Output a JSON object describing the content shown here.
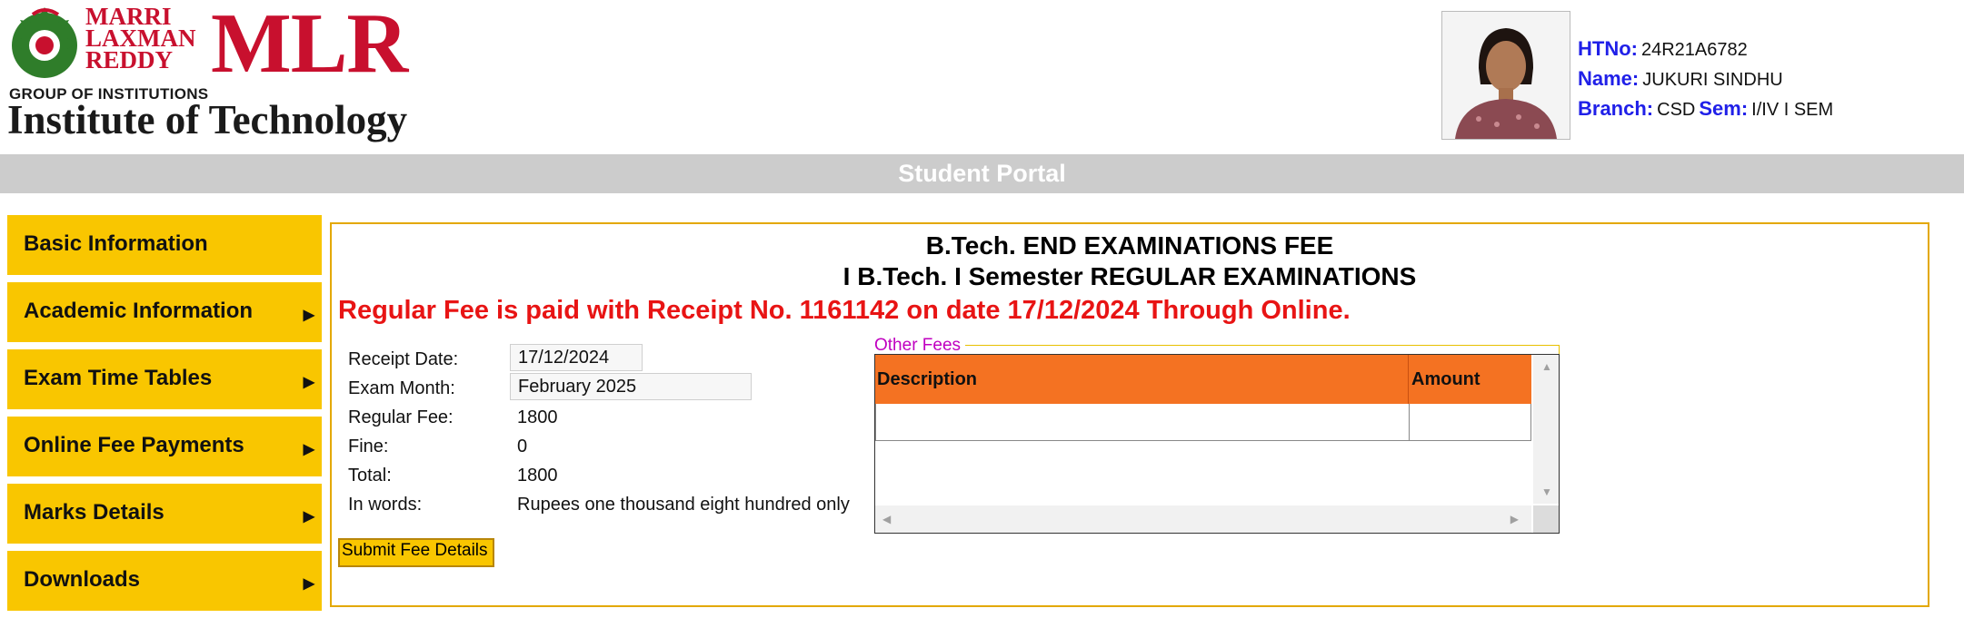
{
  "logo": {
    "top_lines": [
      "MARRI",
      "LAXMAN",
      "REDDY"
    ],
    "big": "MLR",
    "group": "GROUP OF INSTITUTIONS",
    "institute": "Institute of Technology"
  },
  "student": {
    "htno_label": "HTNo:",
    "htno": "24R21A6782",
    "name_label": "Name:",
    "name": "JUKURI SINDHU",
    "branch_label": "Branch:",
    "branch": "CSD",
    "sem_label": "Sem:",
    "sem": "I/IV I SEM"
  },
  "portal_title": "Student Portal",
  "sidebar": {
    "items": [
      {
        "label": "Basic Information",
        "arrow": ""
      },
      {
        "label": "Academic Information",
        "arrow": "▶"
      },
      {
        "label": "Exam Time Tables",
        "arrow": "▶"
      },
      {
        "label": "Online Fee Payments",
        "arrow": "▶"
      },
      {
        "label": "Marks Details",
        "arrow": "▶"
      },
      {
        "label": "Downloads",
        "arrow": "▶"
      }
    ]
  },
  "main": {
    "title1": "B.Tech. END EXAMINATIONS FEE",
    "title2": "I B.Tech. I Semester REGULAR EXAMINATIONS",
    "paid_message": "Regular Fee is paid with Receipt No. 1161142 on date 17/12/2024 Through Online.",
    "fees": {
      "receipt_date_label": "Receipt Date:",
      "receipt_date": "17/12/2024",
      "exam_month_label": "Exam Month:",
      "exam_month": "February 2025",
      "regular_fee_label": "Regular Fee:",
      "regular_fee": "1800",
      "fine_label": "Fine:",
      "fine": "0",
      "total_label": "Total:",
      "total": "1800",
      "words_label": "In words:",
      "words": "Rupees one thousand eight hundred only"
    },
    "submit_label": "Submit Fee Details",
    "other_fees": {
      "legend": "Other Fees",
      "columns": [
        "Description",
        "Amount"
      ]
    }
  },
  "colors": {
    "menu": "#f9c600",
    "portal_bar": "#cccccc",
    "paid_text": "#e81414",
    "label_blue": "#2020e8",
    "table_header": "#f47222",
    "legend": "#c000c0"
  }
}
